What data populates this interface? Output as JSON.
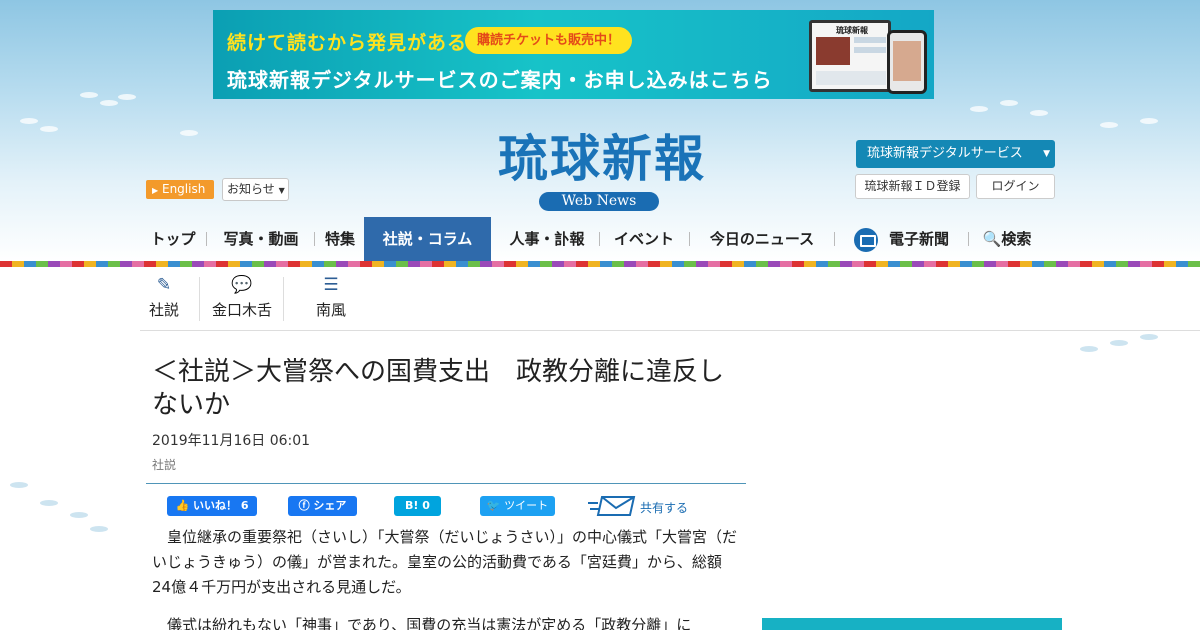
{
  "banner": {
    "tagline": "続けて読むから発見がある",
    "ticket": "購読チケットも販売中！",
    "headline": "琉球新報デジタルサービスのご案内・お申し込みはこちら",
    "device_title": "琉球新報"
  },
  "header": {
    "logo": "琉球新報",
    "logo_sub": "Web News",
    "english": "English",
    "notice": "お知らせ",
    "digital_service": "琉球新報デジタルサービス",
    "id_register": "琉球新報ＩＤ登録",
    "login": "ログイン"
  },
  "nav": {
    "items": [
      "トップ",
      "写真・動画",
      "特集",
      "社説・コラム",
      "人事・訃報",
      "イベント",
      "今日のニュース",
      "電子新聞",
      "検索"
    ],
    "active": "社説・コラム"
  },
  "subnav": {
    "items": [
      "社説",
      "金口木舌",
      "南風"
    ]
  },
  "article": {
    "title": "＜社説＞大嘗祭への国費支出　政教分離に違反しないか",
    "date": "2019年11月16日 06:01",
    "category": "社説",
    "paragraphs": [
      "　皇位継承の重要祭祀（さいし）「大嘗祭（だいじょうさい）」の中心儀式「大嘗宮（だいじょうきゅう）の儀」が営まれた。皇室の公的活動費である「宮廷費」から、総額24億４千万円が支出される見通しだ。",
      "　儀式は紛れもない「神事」であり、国費の充当は憲法が定める「政教分離」に"
    ]
  },
  "share": {
    "facebook_like": "いいね！ 6",
    "facebook_share": "シェア",
    "hatena": "0",
    "twitter": "ツイート",
    "mail": "共有する"
  },
  "colors": {
    "brand": "#1a73b8",
    "nav_active": "#2f6aab",
    "english_btn": "#f39a2b",
    "digital_btn": "#1488b5"
  }
}
